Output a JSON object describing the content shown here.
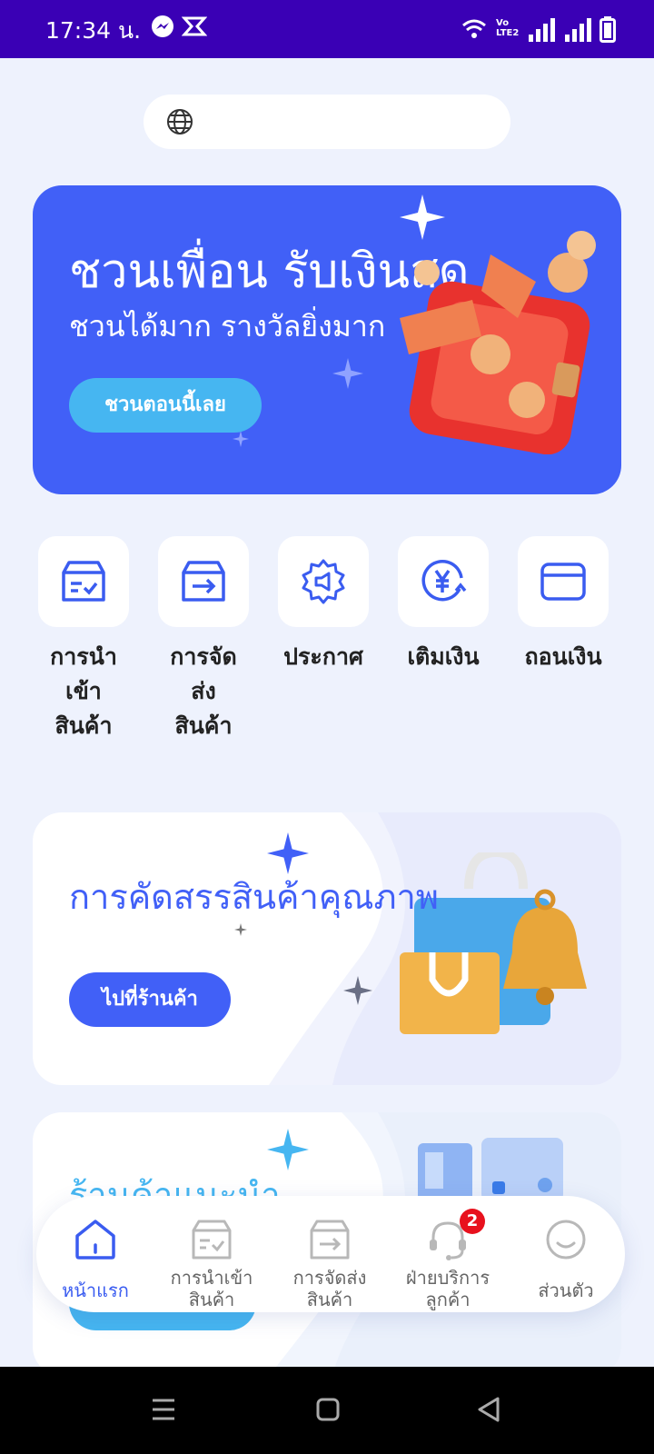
{
  "status_bar": {
    "time": "17:34 น.",
    "network_label": "Vo LTE2",
    "colors": {
      "background": "#3a00b5"
    }
  },
  "search": {
    "icon": "globe-icon",
    "value": ""
  },
  "banner": {
    "title": "ชวนเพื่อน รับเงินสด",
    "subtitle": "ชวนได้มาก รางวัลยิ่งมาก",
    "button_label": "ชวนตอนนี้เลย",
    "colors": {
      "background": "#4160f7",
      "button": "#46b6f1"
    }
  },
  "actions": [
    {
      "label": "การนำ\nเข้า\nสินค้า",
      "icon": "inbox-check-icon"
    },
    {
      "label": "การจัด\nส่ง\nสินค้า",
      "icon": "box-arrow-icon"
    },
    {
      "label": "ประกาศ",
      "icon": "megaphone-gear-icon"
    },
    {
      "label": "เติมเงิน",
      "icon": "yen-refresh-icon"
    },
    {
      "label": "ถอนเงิน",
      "icon": "card-icon"
    }
  ],
  "promo_cards": [
    {
      "title": "การคัดสรรสินค้าคุณภาพ",
      "button_label": "ไปที่ร้านค้า"
    },
    {
      "title": "ร้านค้าแนะนำ",
      "button_label": ""
    }
  ],
  "bottom_nav": [
    {
      "label": "หน้าแรก",
      "icon": "home-icon",
      "active": true
    },
    {
      "label": "การนำเข้า\nสินค้า",
      "icon": "inbox-check-icon",
      "active": false
    },
    {
      "label": "การจัดส่ง\nสินค้า",
      "icon": "box-arrow-icon",
      "active": false
    },
    {
      "label": "ฝ่ายบริการ\nลูกค้า",
      "icon": "headset-icon",
      "active": false,
      "badge": "2"
    },
    {
      "label": "ส่วนตัว",
      "icon": "smiley-icon",
      "active": false
    }
  ],
  "colors": {
    "accent": "#4160f7",
    "accent_light": "#46b6f1",
    "page_background": "#eef2fd"
  }
}
